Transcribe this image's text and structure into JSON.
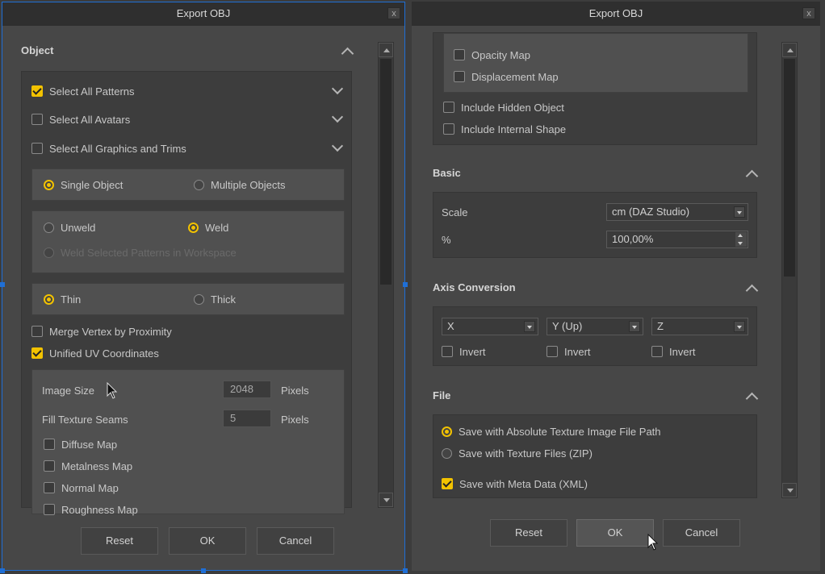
{
  "left": {
    "title": "Export OBJ",
    "close_glyph": "x",
    "object_header": "Object",
    "select_patterns": "Select All Patterns",
    "select_avatars": "Select All Avatars",
    "select_graphics": "Select All Graphics and Trims",
    "single_object": "Single Object",
    "multiple_objects": "Multiple Objects",
    "unweld": "Unweld",
    "weld": "Weld",
    "weld_selected": "Weld Selected Patterns in Workspace",
    "thin": "Thin",
    "thick": "Thick",
    "merge_vertex": "Merge Vertex by Proximity",
    "unified_uv": "Unified UV Coordinates",
    "image_size_label": "Image Size",
    "image_size_value": "2048",
    "image_size_unit": "Pixels",
    "fill_seams_label": "Fill Texture Seams",
    "fill_seams_value": "5",
    "fill_seams_unit": "Pixels",
    "diffuse_map": "Diffuse Map",
    "metalness_map": "Metalness Map",
    "normal_map": "Normal Map",
    "roughness_map": "Roughness Map",
    "reset": "Reset",
    "ok": "OK",
    "cancel": "Cancel"
  },
  "right": {
    "title": "Export OBJ",
    "close_glyph": "x",
    "opacity_map": "Opacity Map",
    "displacement_map": "Displacement Map",
    "include_hidden": "Include Hidden Object",
    "include_internal": "Include Internal Shape",
    "basic_header": "Basic",
    "scale_label": "Scale",
    "scale_value": "cm (DAZ Studio)",
    "percent_label": "%",
    "percent_value": "100,00%",
    "axis_header": "Axis Conversion",
    "axis_x": "X",
    "axis_y": "Y (Up)",
    "axis_z": "Z",
    "invert": "Invert",
    "file_header": "File",
    "save_absolute": "Save with Absolute Texture Image File Path",
    "save_zip": "Save with Texture Files (ZIP)",
    "save_meta": "Save with Meta Data (XML)",
    "reset": "Reset",
    "ok": "OK",
    "cancel": "Cancel"
  },
  "colors": {
    "accent": "#f2c200",
    "panel": "#474747",
    "titlebar": "#2f2f2f"
  }
}
